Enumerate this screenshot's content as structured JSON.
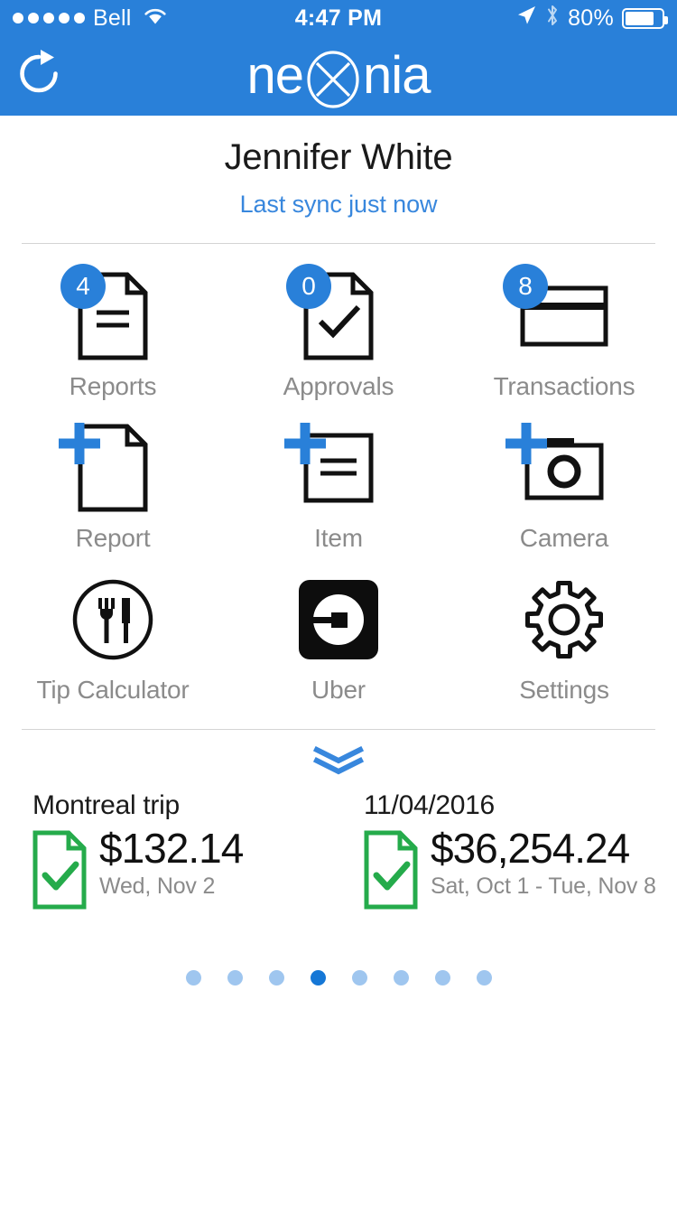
{
  "status_bar": {
    "carrier": "Bell",
    "signal_dots": 5,
    "wifi_icon": "wifi-icon",
    "time": "4:47 PM",
    "location_icon": "location-arrow-icon",
    "bluetooth_icon": "bluetooth-icon",
    "battery_percent": "80%",
    "battery_level": 80
  },
  "navbar": {
    "refresh_icon": "refresh-icon",
    "brand_prefix": "ne",
    "brand_suffix": "nia",
    "brand_mark": "circled-x-logo",
    "background": "#2980d9"
  },
  "header": {
    "user_name": "Jennifer White",
    "sync_status": "Last sync just now",
    "sync_color": "#3887dd"
  },
  "grid": {
    "rows": [
      [
        {
          "label": "Reports",
          "icon": "document-lines-icon",
          "badge": "4",
          "name": "reports"
        },
        {
          "label": "Approvals",
          "icon": "document-check-icon",
          "badge": "0",
          "name": "approvals"
        },
        {
          "label": "Transactions",
          "icon": "credit-card-icon",
          "badge": "8",
          "name": "transactions"
        }
      ],
      [
        {
          "label": "Report",
          "icon": "document-blank-icon",
          "plus": true,
          "name": "add-report"
        },
        {
          "label": "Item",
          "icon": "square-lines-icon",
          "plus": true,
          "name": "add-item"
        },
        {
          "label": "Camera",
          "icon": "camera-icon",
          "plus": true,
          "name": "add-camera"
        }
      ],
      [
        {
          "label": "Tip Calculator",
          "icon": "fork-knife-circle-icon",
          "name": "tip-calculator"
        },
        {
          "label": "Uber",
          "icon": "uber-logo-icon",
          "name": "uber"
        },
        {
          "label": "Settings",
          "icon": "gear-icon",
          "name": "settings"
        }
      ]
    ]
  },
  "expand": {
    "icon": "double-chevron-down-icon",
    "color": "#3887dd"
  },
  "cards": [
    {
      "title": "Montreal trip",
      "amount": "$132.14",
      "date": "Wed, Nov 2",
      "status_icon": "document-approved-green-icon",
      "status_color": "#25ab4b"
    },
    {
      "title": "11/04/2016",
      "amount": "$36,254.24",
      "date": "Sat, Oct 1 - Tue, Nov 8",
      "status_icon": "document-approved-green-icon",
      "status_color": "#25ab4b"
    }
  ],
  "pager": {
    "total": 8,
    "active_index": 3,
    "active_color": "#1577d6",
    "inactive_color": "#9fc6ef"
  }
}
